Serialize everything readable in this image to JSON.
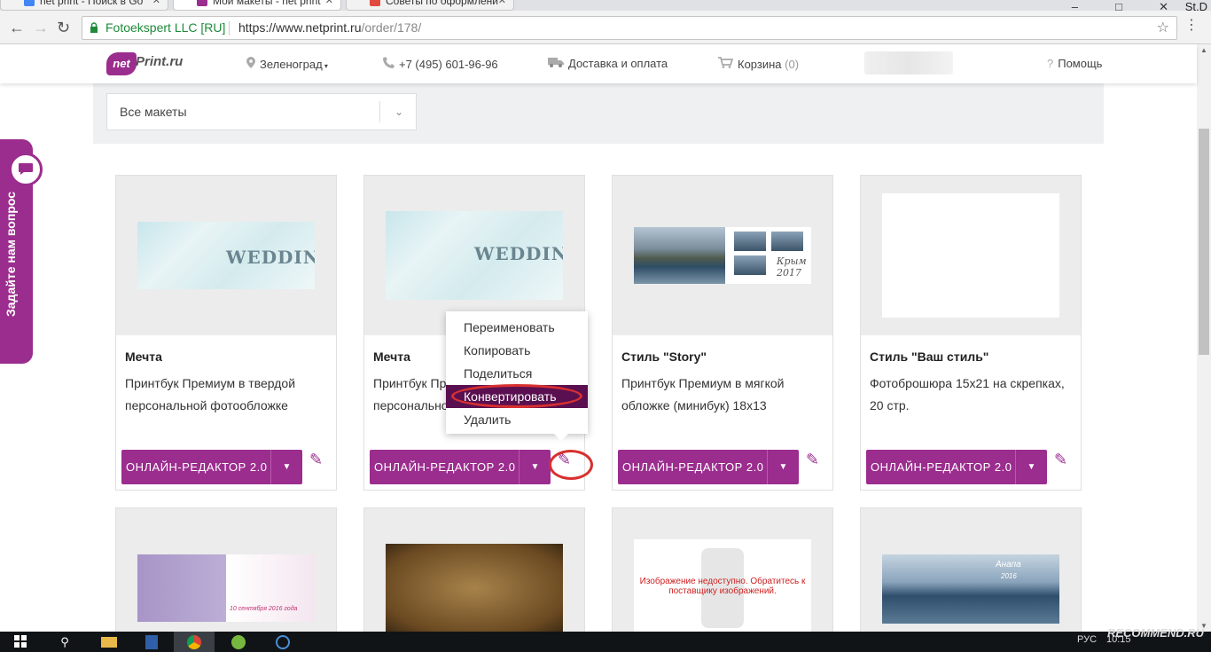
{
  "browser": {
    "tabs": [
      {
        "title": "net print - Поиск в Go",
        "active": false
      },
      {
        "title": "Мои макеты - net print",
        "active": true
      },
      {
        "title": "Советы по оформлени",
        "active": false
      }
    ],
    "window_user": "St.D",
    "secure_label": "Fotoekspert LLC [RU]",
    "url_host": "https://www.netprint.ru",
    "url_path": "/order/178/"
  },
  "header": {
    "logo_net": "net",
    "logo_print": "Print.ru",
    "city": "Зеленоград",
    "phone": "+7 (495) 601-96-96",
    "delivery": "Доставка и оплата",
    "cart_label": "Корзина",
    "cart_count": "(0)",
    "help": "Помощь"
  },
  "filter": {
    "selected": "Все макеты"
  },
  "feedback": {
    "label": "Задайте нам вопрос"
  },
  "cards": [
    {
      "title": "Мечта",
      "desc": "Принтбук Премиум в твердой персональной фотообложке",
      "button": "ОНЛАЙН-РЕДАКТОР 2.0"
    },
    {
      "title": "Мечта",
      "desc": "Принтбук Премиум в твердой персональной фотообложке",
      "button": "ОНЛАЙН-РЕДАКТОР 2.0"
    },
    {
      "title": "Стиль \"Story\"",
      "desc": "Принтбук Премиум в мягкой обложке (минибук) 18х13",
      "button": "ОНЛАЙН-РЕДАКТОР 2.0"
    },
    {
      "title": "Стиль \"Ваш стиль\"",
      "desc": "Фотоброшюра 15х21 на скрепках, 20 стр.",
      "button": "ОНЛАЙН-РЕДАКТОР 2.0"
    }
  ],
  "thumbs": {
    "wedding_text": "WEDDING",
    "crimea_caption_1": "Крым",
    "crimea_caption_2": "2017",
    "unavailable": "Изображение недоступно. Обратитесь к поставщику изображений.",
    "anapa": "Анапа",
    "anapa_year": "2016",
    "date_caption": "10 сентября 2016 года"
  },
  "context_menu": {
    "items": [
      "Переименовать",
      "Копировать",
      "Поделиться",
      "Конвертировать",
      "Удалить"
    ],
    "selected": "Конвертировать"
  },
  "taskbar": {
    "lang": "РУС",
    "time": "10:15"
  },
  "watermark": "RECOMMEND.RU",
  "colors": {
    "brand": "#9b2d8e",
    "menu_selected": "#5a1050",
    "highlight": "#d83030"
  }
}
